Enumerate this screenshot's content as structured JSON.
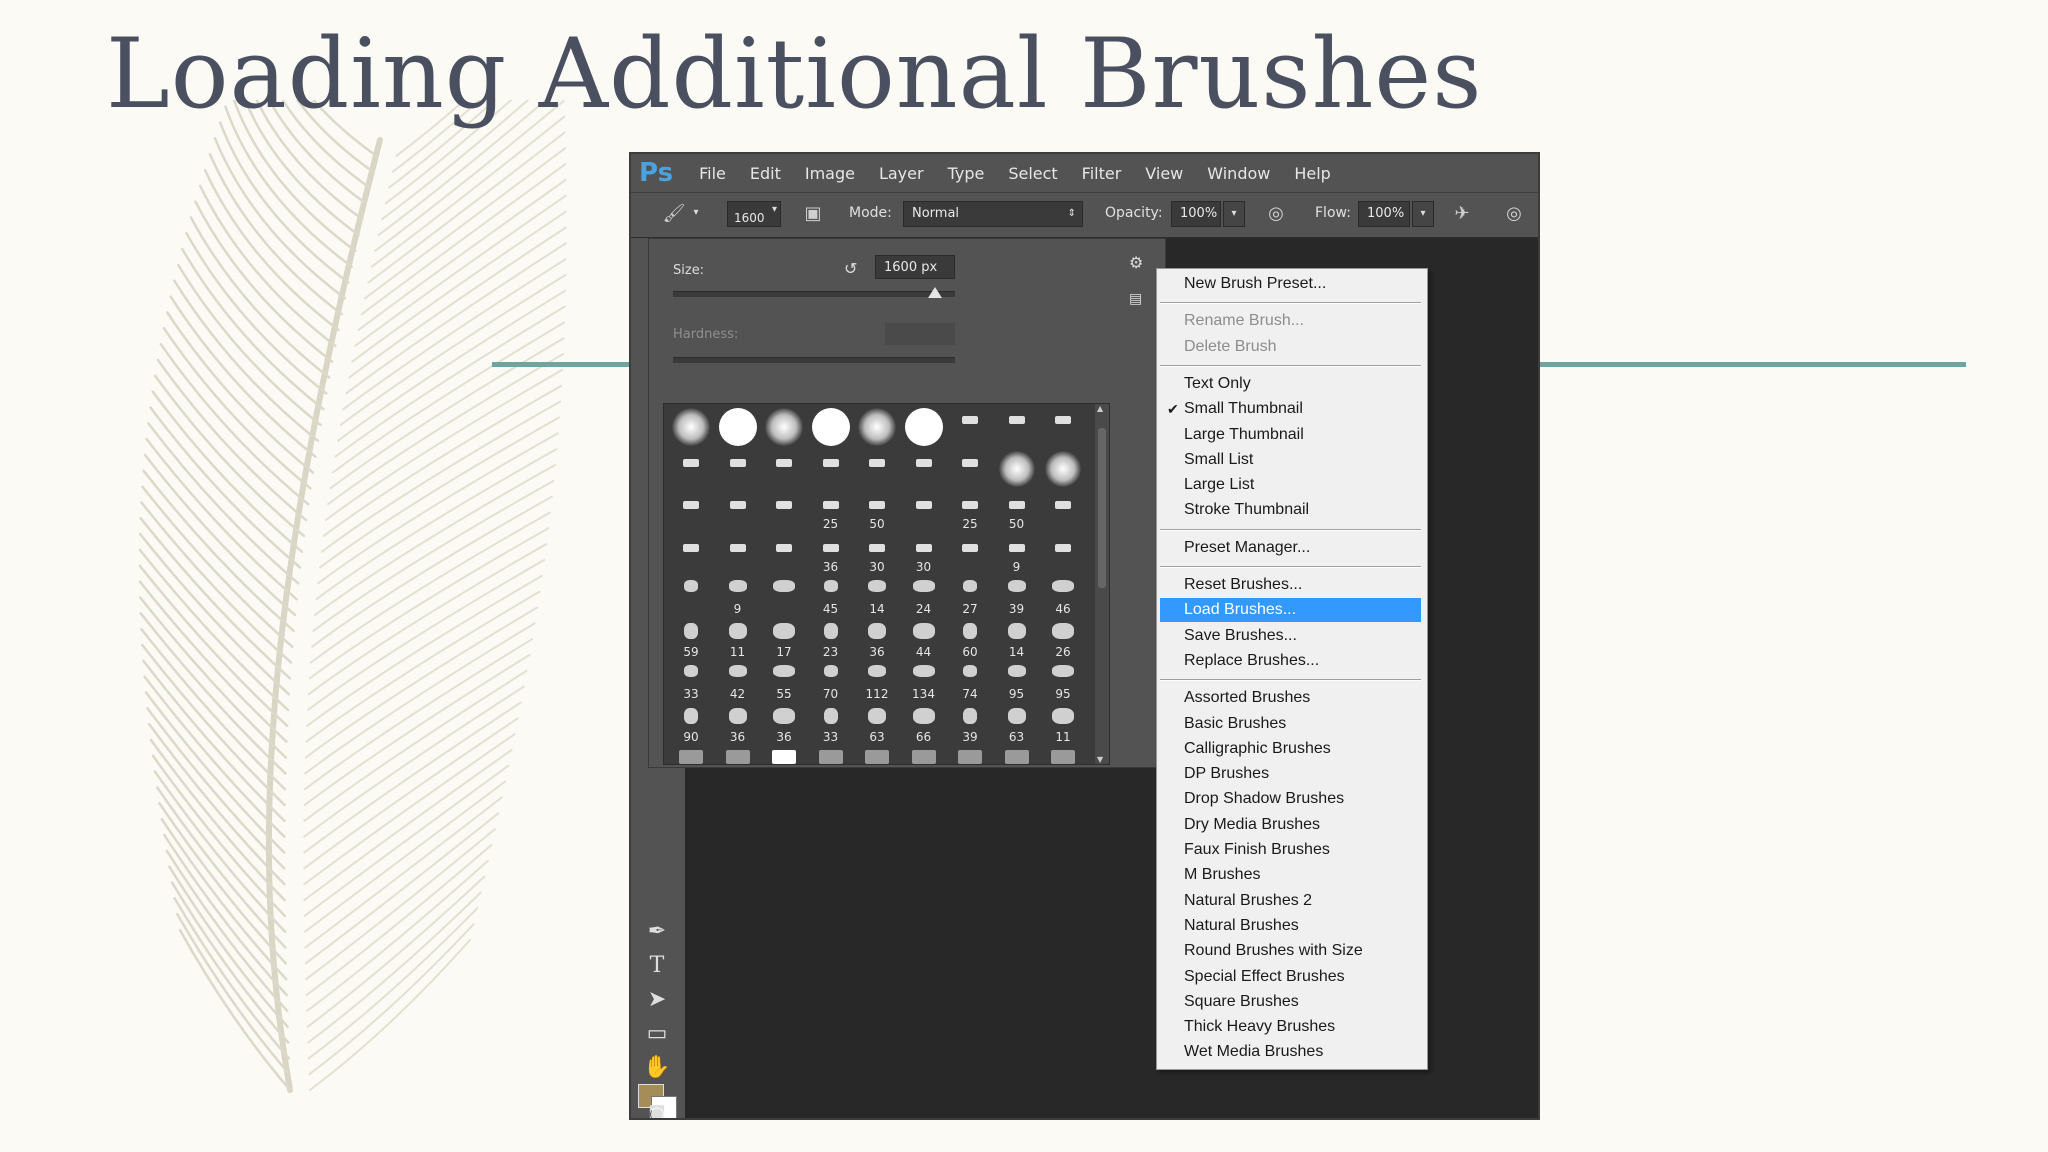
{
  "slide": {
    "title": "Loading Additional Brushes"
  },
  "colors": {
    "accent_line": "#6ea5a0",
    "menu_highlight": "#3399ff",
    "foreground_color": "#a58d5a",
    "background_color": "#ffffff"
  },
  "photoshop": {
    "logo": "Ps",
    "menubar": [
      "File",
      "Edit",
      "Image",
      "Layer",
      "Type",
      "Select",
      "Filter",
      "View",
      "Window",
      "Help"
    ],
    "options_bar": {
      "brush_size": "1600",
      "mode_label": "Mode:",
      "mode_value": "Normal",
      "opacity_label": "Opacity:",
      "opacity_value": "100%",
      "flow_label": "Flow:",
      "flow_value": "100%"
    },
    "brush_panel": {
      "size_label": "Size:",
      "size_value": "1600 px",
      "hardness_label": "Hardness:",
      "brush_numbers": [
        [
          "",
          "",
          "",
          "",
          "",
          "",
          "",
          "",
          ""
        ],
        [
          "",
          "",
          "",
          "",
          "",
          "",
          "",
          "",
          ""
        ],
        [
          "",
          "",
          "",
          "25",
          "50",
          "",
          "25",
          "50",
          ""
        ],
        [
          "",
          "",
          "",
          "36",
          "30",
          "30",
          "",
          "9",
          ""
        ],
        [
          "",
          "9",
          "",
          "45",
          "14",
          "24",
          "27",
          "39",
          "46"
        ],
        [
          "59",
          "11",
          "17",
          "23",
          "36",
          "44",
          "60",
          "14",
          "26"
        ],
        [
          "33",
          "42",
          "55",
          "70",
          "112",
          "134",
          "74",
          "95",
          "95"
        ],
        [
          "90",
          "36",
          "36",
          "33",
          "63",
          "66",
          "39",
          "63",
          "11"
        ],
        [
          "",
          "",
          "",
          "",
          "",
          "",
          "",
          "",
          ""
        ]
      ]
    },
    "context_menu": {
      "groups": [
        [
          {
            "label": "New Brush Preset..."
          }
        ],
        [
          {
            "label": "Rename Brush...",
            "disabled": true
          },
          {
            "label": "Delete Brush",
            "disabled": true
          }
        ],
        [
          {
            "label": "Text Only"
          },
          {
            "label": "Small Thumbnail",
            "checked": true
          },
          {
            "label": "Large Thumbnail"
          },
          {
            "label": "Small List"
          },
          {
            "label": "Large List"
          },
          {
            "label": "Stroke Thumbnail"
          }
        ],
        [
          {
            "label": "Preset Manager..."
          }
        ],
        [
          {
            "label": "Reset Brushes..."
          },
          {
            "label": "Load Brushes...",
            "highlighted": true
          },
          {
            "label": "Save Brushes..."
          },
          {
            "label": "Replace Brushes..."
          }
        ],
        [
          {
            "label": "Assorted Brushes"
          },
          {
            "label": "Basic Brushes"
          },
          {
            "label": "Calligraphic Brushes"
          },
          {
            "label": "DP Brushes"
          },
          {
            "label": "Drop Shadow Brushes"
          },
          {
            "label": "Dry Media Brushes"
          },
          {
            "label": "Faux Finish Brushes"
          },
          {
            "label": "M Brushes"
          },
          {
            "label": "Natural Brushes 2"
          },
          {
            "label": "Natural Brushes"
          },
          {
            "label": "Round Brushes with Size"
          },
          {
            "label": "Special Effect Brushes"
          },
          {
            "label": "Square Brushes"
          },
          {
            "label": "Thick Heavy Brushes"
          },
          {
            "label": "Wet Media Brushes"
          }
        ]
      ]
    }
  }
}
